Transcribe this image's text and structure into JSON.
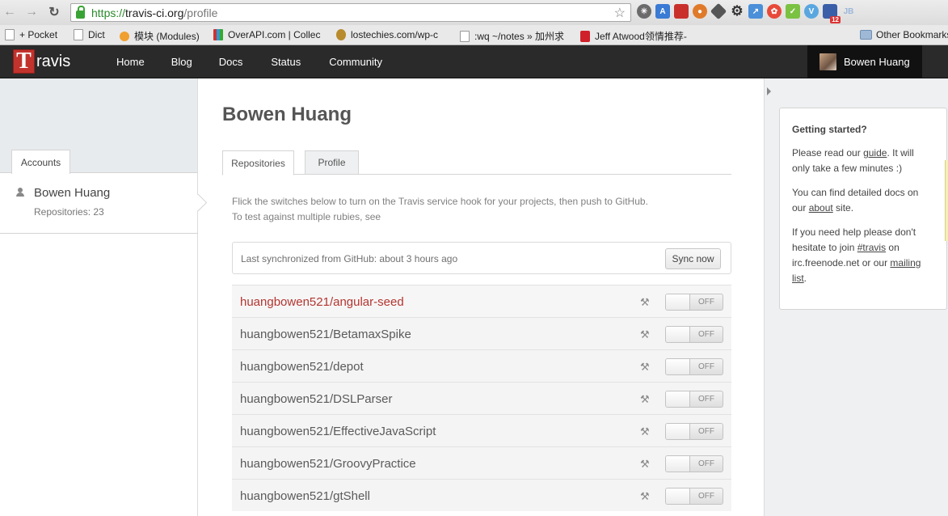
{
  "browser": {
    "url_scheme": "https://",
    "url_host": "travis-ci.org",
    "url_path": "/profile",
    "bookmarks": [
      {
        "label": "+ Pocket"
      },
      {
        "label": "Dict"
      },
      {
        "label": "模块 (Modules)"
      },
      {
        "label": "OverAPI.com | Collec"
      },
      {
        "label": "lostechies.com/wp-c"
      },
      {
        "label": ":wq ~/notes » 加州求"
      },
      {
        "label": "Jeff Atwood领情推荐-"
      }
    ],
    "other_bookmarks": "Other Bookmarks",
    "ext_badge": "12"
  },
  "header": {
    "logo_letter": "T",
    "logo_text": "ravis",
    "nav": [
      "Home",
      "Blog",
      "Docs",
      "Status",
      "Community"
    ],
    "user_name": "Bowen Huang"
  },
  "sidebar": {
    "tab_label": "Accounts",
    "account_name": "Bowen Huang",
    "account_repos": "Repositories: 23"
  },
  "main": {
    "title": "Bowen Huang",
    "tabs": [
      "Repositories",
      "Profile"
    ],
    "intro_line1": "Flick the switches below to turn on the Travis service hook for your projects, then push to GitHub.",
    "intro_line2": "To test against multiple rubies, see",
    "sync_text": "Last synchronized from GitHub: about 3 hours ago",
    "sync_button": "Sync now",
    "repos": [
      {
        "name": "huangbowen521/angular-seed",
        "state": "OFF"
      },
      {
        "name": "huangbowen521/BetamaxSpike",
        "state": "OFF"
      },
      {
        "name": "huangbowen521/depot",
        "state": "OFF"
      },
      {
        "name": "huangbowen521/DSLParser",
        "state": "OFF"
      },
      {
        "name": "huangbowen521/EffectiveJavaScript",
        "state": "OFF"
      },
      {
        "name": "huangbowen521/GroovyPractice",
        "state": "OFF"
      },
      {
        "name": "huangbowen521/gtShell",
        "state": "OFF"
      }
    ]
  },
  "help": {
    "title": "Getting started?",
    "p1_a": "Please read our ",
    "p1_link": "guide",
    "p1_b": ". It will only take a few minutes :)",
    "p2_a": "You can find detailed docs on our ",
    "p2_link": "about",
    "p2_b": " site.",
    "p3_a": "If you need help please don't hesitate to join ",
    "p3_link1": "#travis",
    "p3_b": " on irc.freenode.net or our ",
    "p3_link2": "mailing list",
    "p3_c": "."
  }
}
